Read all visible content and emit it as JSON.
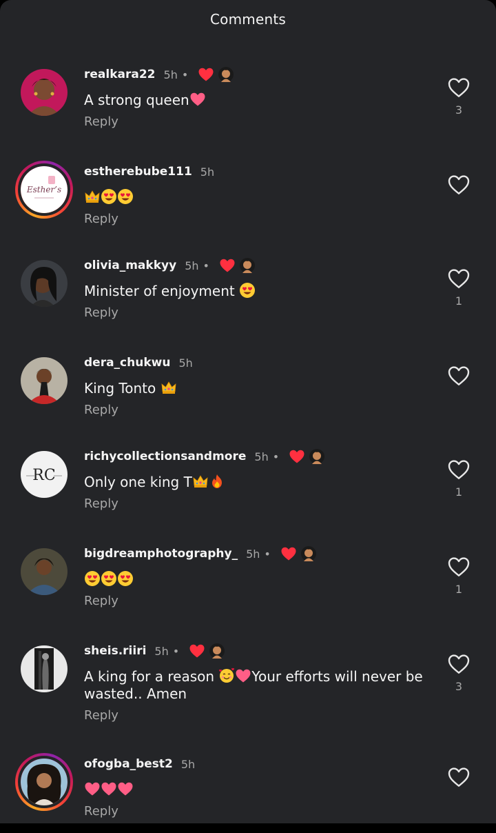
{
  "header": {
    "title": "Comments"
  },
  "comments": [
    {
      "username": "realkara22",
      "time": "5h",
      "dot": "•",
      "author_liked": true,
      "text": "A strong queen",
      "emoji": [
        "heart-pink"
      ],
      "reply": "Reply",
      "likes": "3",
      "avatar": "realkara22-avatar",
      "ring": false
    },
    {
      "username": "estherebube111",
      "time": "5h",
      "dot": "",
      "author_liked": false,
      "text": "",
      "emoji": [
        "crown",
        "heart-eyes",
        "heart-eyes"
      ],
      "reply": "Reply",
      "likes": "",
      "avatar": "esthers-logo-avatar",
      "ring": true
    },
    {
      "username": "olivia_makkyy",
      "time": "5h",
      "dot": "•",
      "author_liked": true,
      "text": "Minister of enjoyment ",
      "emoji": [
        "heart-eyes"
      ],
      "reply": "Reply",
      "likes": "1",
      "avatar": "olivia-avatar",
      "ring": false
    },
    {
      "username": "dera_chukwu",
      "time": "5h",
      "dot": "",
      "author_liked": false,
      "text": "King Tonto ",
      "emoji": [
        "crown"
      ],
      "reply": "Reply",
      "likes": "",
      "avatar": "dera-avatar",
      "ring": false
    },
    {
      "username": "richycollectionsandmore",
      "time": "5h",
      "dot": "•",
      "author_liked": true,
      "text": "Only one king T",
      "emoji": [
        "crown",
        "fire"
      ],
      "reply": "Reply",
      "likes": "1",
      "avatar": "rc-logo-avatar",
      "ring": false
    },
    {
      "username": "bigdreamphotography_",
      "time": "5h",
      "dot": "•",
      "author_liked": true,
      "text": "",
      "emoji": [
        "heart-eyes",
        "heart-eyes",
        "heart-eyes"
      ],
      "reply": "Reply",
      "likes": "1",
      "avatar": "bigdream-avatar",
      "ring": false
    },
    {
      "username": "sheis.riiri",
      "time": "5h",
      "dot": "•",
      "author_liked": true,
      "text": "A king for a reason ",
      "emoji_mid": [
        "smiling-hearts",
        "heart-pink"
      ],
      "text_after": "Your efforts will never be wasted.. Amen",
      "reply": "Reply",
      "likes": "3",
      "avatar": "sheis-avatar",
      "ring": false
    },
    {
      "username": "ofogba_best2",
      "time": "5h",
      "dot": "",
      "author_liked": false,
      "text": "",
      "emoji": [
        "heart-pink",
        "heart-pink",
        "heart-pink"
      ],
      "reply": "Reply",
      "likes": "",
      "avatar": "ofogba-avatar",
      "ring": true
    }
  ],
  "colors": {
    "background": "#242528",
    "secondary_text": "#a8a8a8",
    "like_red": "#ff3040"
  },
  "icons": {
    "like": "heart-outline-icon",
    "author_like": "heart-filled-icon"
  }
}
